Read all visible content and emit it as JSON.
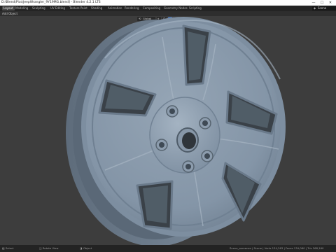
{
  "window": {
    "title": "D:\\Blend\\Pics\\JeepWrangler_9Y19MG.blend] - Blender 4.2.1 LTS",
    "controls": [
      "—",
      "□",
      "✕"
    ]
  },
  "workspace_tabs": [
    {
      "label": "Layout",
      "active": true
    },
    {
      "label": "Modeling",
      "active": false
    },
    {
      "label": "Sculpting",
      "active": false
    },
    {
      "label": "UV Editing",
      "active": false
    },
    {
      "label": "Texture Paint",
      "active": false
    },
    {
      "label": "Shading",
      "active": false
    },
    {
      "label": "Animation",
      "active": false
    },
    {
      "label": "Rendering",
      "active": false
    },
    {
      "label": "Compositing",
      "active": false
    },
    {
      "label": "Geometry Nodes",
      "active": false
    },
    {
      "label": "Scripting",
      "active": false
    }
  ],
  "scene_selector": {
    "label": "Scene"
  },
  "header_menu": [
    "Add",
    "Object"
  ],
  "viewport_toolbar": {
    "orientation": "Global"
  },
  "status_bar": {
    "left_items": [
      "Select",
      "Rotate View",
      "Object"
    ],
    "right_text": "Scene_axmenes | Scene | Verts 134,263 | Faces 134,080 | Tris 268,160"
  },
  "colors": {
    "viewport_bg": "#3d3d3d",
    "wheel_base": "#8898a8",
    "accent": "#4772b3"
  }
}
